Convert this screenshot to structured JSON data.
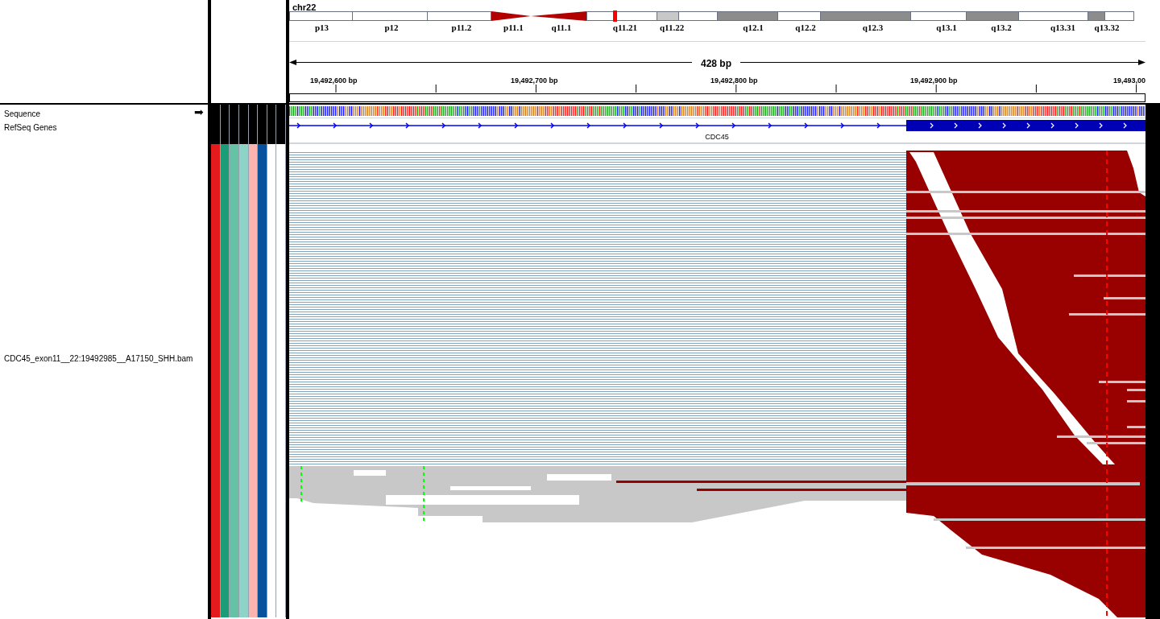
{
  "chromosome": "chr22",
  "ideogram_bands": [
    {
      "label": "p13",
      "kind": "gneg"
    },
    {
      "label": "p12",
      "kind": "gneg"
    },
    {
      "label": "p11.2",
      "kind": "gneg"
    },
    {
      "label": "p11.1",
      "kind": "acenp"
    },
    {
      "label": "q11.1",
      "kind": "acenq"
    },
    {
      "label": "q11.21",
      "kind": "gneg"
    },
    {
      "label": "q11.22",
      "kind": "gpos25"
    },
    {
      "kind": "gneg"
    },
    {
      "label": "q12.1",
      "kind": "gpos50"
    },
    {
      "label": "q12.2",
      "kind": "gneg"
    },
    {
      "label": "q12.3",
      "kind": "gpos50"
    },
    {
      "label": "q13.1",
      "kind": "gneg"
    },
    {
      "label": "q13.2",
      "kind": "gpos50"
    },
    {
      "label": "q13.31",
      "kind": "gneg"
    },
    {
      "label": "q13.32",
      "kind": "gpos50"
    },
    {
      "kind": "gneg"
    }
  ],
  "ruler": {
    "span": "428 bp",
    "ticks": [
      "19,492,600 bp",
      "19,492,700 bp",
      "19,492,800 bp",
      "19,492,900 bp",
      "19,493,00"
    ]
  },
  "tracks": [
    {
      "name": "Sequence",
      "kind": "sequence",
      "strand_arrow": "➡"
    },
    {
      "name": "RefSeq Genes",
      "kind": "gene",
      "gene_label": "CDC45"
    },
    {
      "name": "CDC45_exon11__22:19492985__A17150_SHH.bam",
      "kind": "alignment"
    }
  ],
  "attributes": [
    {
      "color": "#e41a1c"
    },
    {
      "color": "#1b9e77"
    },
    {
      "color": "#66c2a5"
    },
    {
      "color": "#8dd3c7"
    },
    {
      "color": "#fbb4ae"
    },
    {
      "color": "#08519c"
    },
    {
      "color": "#ffffff"
    },
    {
      "color": "#ffffff"
    }
  ]
}
